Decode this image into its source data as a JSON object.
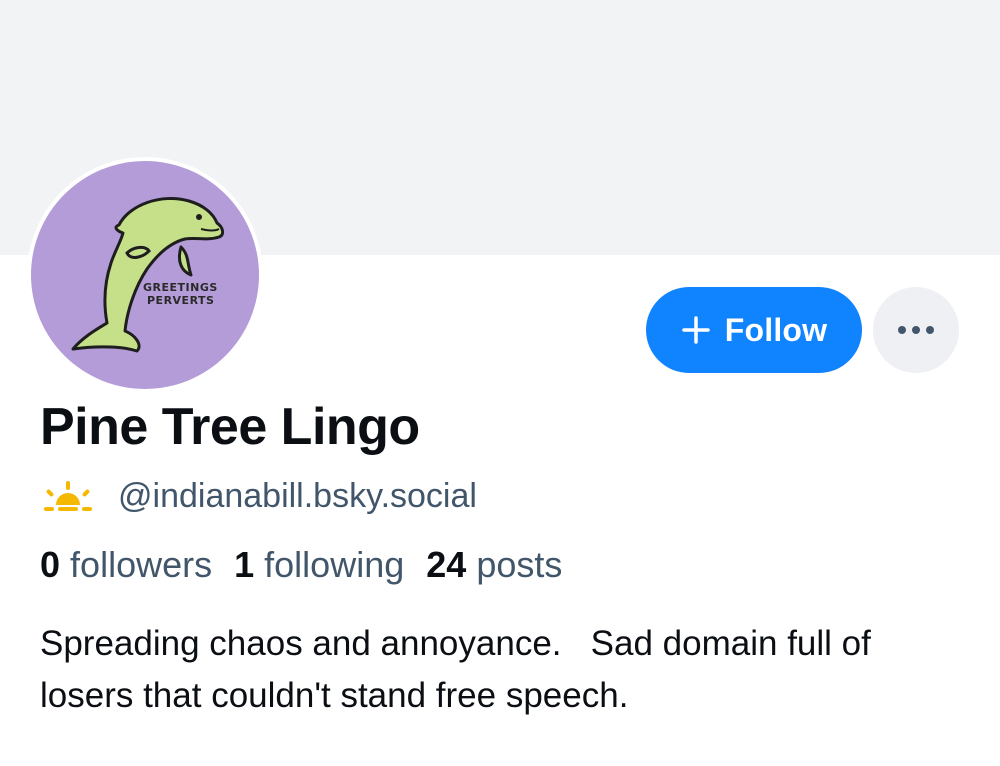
{
  "profile": {
    "display_name": "Pine Tree Lingo",
    "handle": "@indianabill.bsky.social",
    "avatar": {
      "text_line1": "GREETINGS",
      "text_line2": "PERVERTS",
      "background_color": "#b49cd8",
      "dolphin_color": "#c6e08a"
    },
    "handle_badge_icon": "sunrise-icon",
    "stats": {
      "followers_count": "0",
      "followers_label": "followers",
      "following_count": "1",
      "following_label": "following",
      "posts_count": "24",
      "posts_label": "posts"
    },
    "bio": "Spreading chaos and annoyance.   Sad domain full of losers that couldn't stand free speech."
  },
  "actions": {
    "follow_label": "Follow",
    "follow_icon": "plus-icon",
    "more_icon": "ellipsis-icon"
  },
  "colors": {
    "accent": "#1083fe",
    "banner": "#f1f3f5",
    "text_primary": "#0b0f14",
    "text_secondary": "#42566b",
    "badge_yellow": "#f5b800"
  }
}
